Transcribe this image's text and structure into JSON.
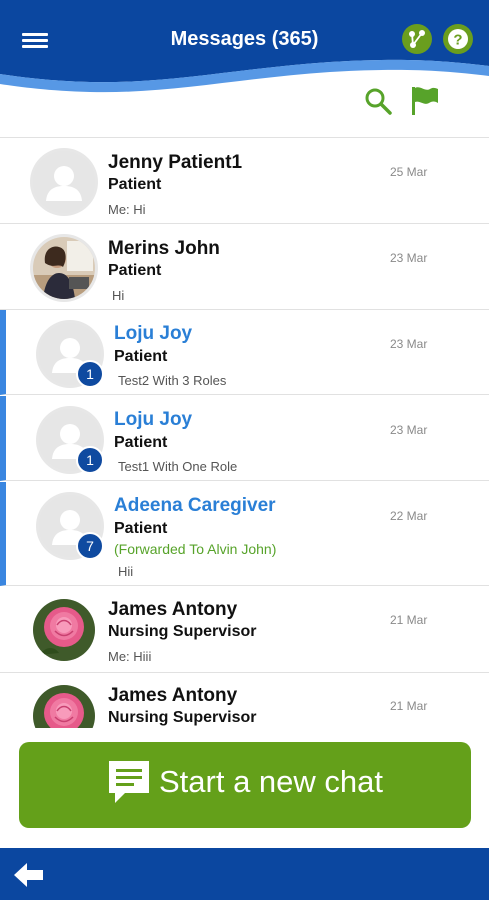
{
  "header": {
    "title": "Messages (365)",
    "help_label": "?",
    "colors": {
      "primary": "#0b47a0",
      "accent_green": "#64a01a",
      "unread_bar": "#3a86e0"
    }
  },
  "toolbar": {
    "search_icon": "search-icon",
    "flag_icon": "flag-icon"
  },
  "conversations": [
    {
      "name": "Jenny Patient1",
      "role": "Patient",
      "preview": "Me: Hi",
      "date": "25 Mar",
      "unread": false,
      "avatar": "placeholder"
    },
    {
      "name": "Merins John",
      "role": "Patient",
      "preview": "Hi",
      "date": "23 Mar",
      "unread": false,
      "avatar": "photo"
    },
    {
      "name": "Loju Joy",
      "role": "Patient",
      "preview": "Test2 With 3 Roles",
      "date": "23 Mar",
      "unread": true,
      "badge": "1",
      "avatar": "placeholder"
    },
    {
      "name": "Loju Joy",
      "role": "Patient",
      "preview": "Test1 With One Role",
      "date": "23 Mar",
      "unread": true,
      "badge": "1",
      "avatar": "placeholder"
    },
    {
      "name": "Adeena Caregiver",
      "role": "Patient",
      "forwarded": "(Forwarded To Alvin John)",
      "preview": "Hii",
      "date": "22 Mar",
      "unread": true,
      "badge": "7",
      "avatar": "placeholder"
    },
    {
      "name": "James Antony",
      "role": "Nursing Supervisor",
      "preview": "Me: Hiii",
      "date": "21 Mar",
      "unread": false,
      "avatar": "rose"
    },
    {
      "name": "James Antony",
      "role": "Nursing Supervisor",
      "preview": "",
      "date": "21 Mar",
      "unread": false,
      "avatar": "rose"
    }
  ],
  "start_chat": {
    "label": "Start a new chat"
  }
}
